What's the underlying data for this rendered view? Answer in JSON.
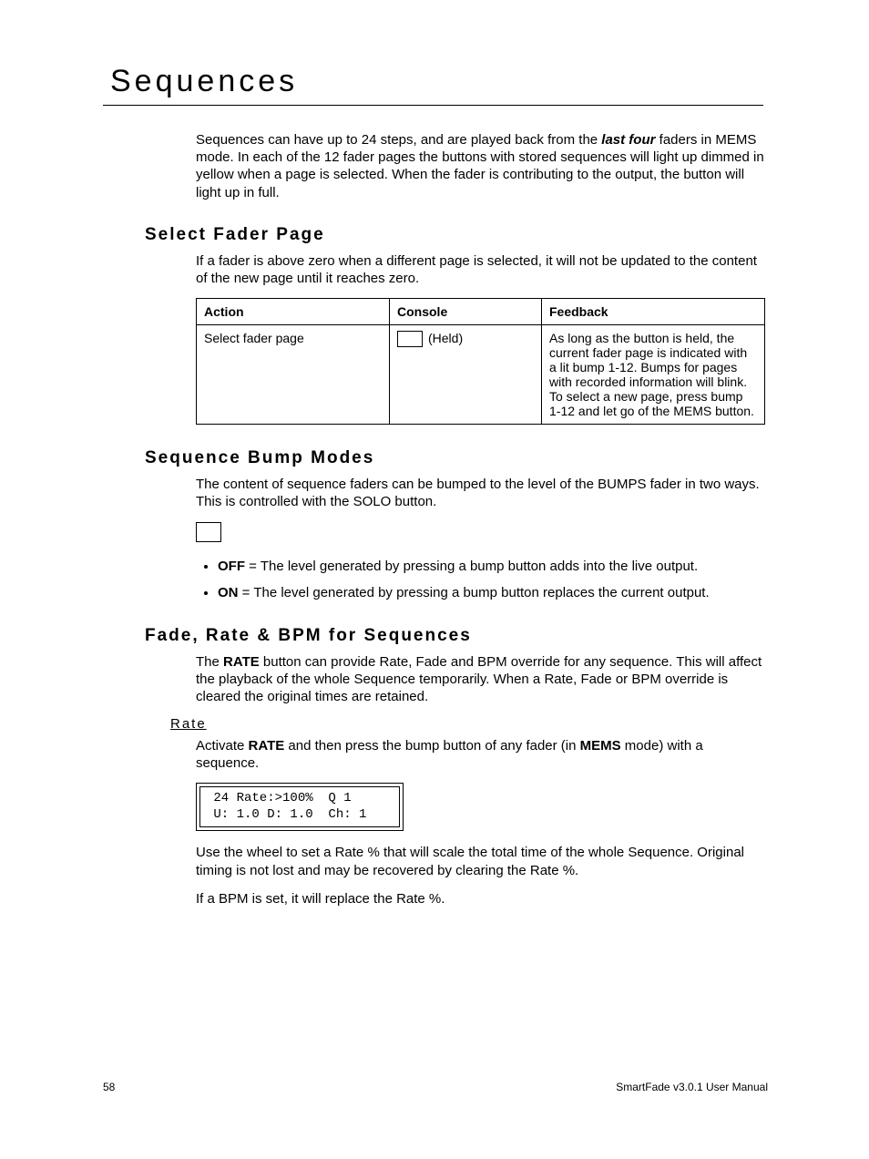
{
  "chapter_title": "Sequences",
  "intro": {
    "p1_a": "Sequences can have up to 24 steps, and are played back from the ",
    "p1_b": "last four",
    "p1_c": " faders in MEMS mode. In each of the 12 fader pages the buttons with stored sequences will light up dimmed in yellow when a page is selected. When the fader is contributing to the output, the button will light up in full."
  },
  "sec1": {
    "title": "Select Fader Page",
    "p1": "If a fader is above zero when a different page is selected, it will not be updated to the content of the new page until it reaches zero.",
    "table": {
      "h1": "Action",
      "h2": "Console",
      "h3": "Feedback",
      "r1c1": "Select fader page",
      "r1c2_label": "(Held)",
      "r1c3": "As long as the button is held, the current fader page is indicated with a lit bump 1-12. Bumps for pages with recorded information will blink. To select a new page, press bump 1-12 and let go of the MEMS button."
    }
  },
  "sec2": {
    "title": "Sequence Bump Modes",
    "p1": "The content of sequence faders can be bumped to the level of the BUMPS fader in two ways. This is controlled with the SOLO button.",
    "b1_strong": "OFF",
    "b1_rest": " = The level generated by pressing a bump button adds into the live output.",
    "b2_strong": "ON",
    "b2_rest": " = The level generated by pressing a bump button replaces the current output."
  },
  "sec3": {
    "title": "Fade, Rate & BPM for Sequences",
    "p1_a": "The ",
    "p1_b": "RATE",
    "p1_c": " button can provide Rate, Fade and BPM override for any sequence. This will affect the playback of the whole Sequence temporarily. When a Rate, Fade or BPM override is cleared the original times are retained.",
    "sub1": "Rate",
    "p2_a": "Activate ",
    "p2_b": "RATE",
    "p2_c": " and then press the bump button of any fader (in ",
    "p2_d": "MEMS",
    "p2_e": " mode) with a sequence.",
    "lcd_l1": " 24 Rate:>100%  Q 1",
    "lcd_l2": " U: 1.0 D: 1.0  Ch: 1",
    "p3": "Use the wheel to set a Rate % that will scale the total time of the whole Sequence. Original timing is not lost and may be recovered by clearing the Rate %.",
    "p4": "If a BPM is set, it will replace the Rate %."
  },
  "footer": {
    "page": "58",
    "doc": "SmartFade v3.0.1 User Manual"
  }
}
